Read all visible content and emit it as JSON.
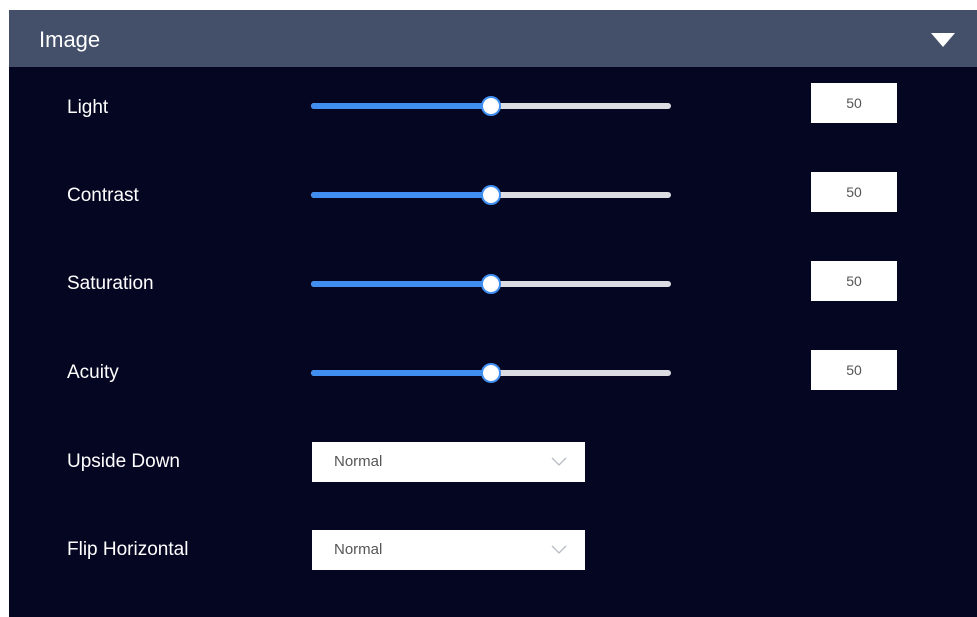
{
  "panel": {
    "title": "Image",
    "toggle_icon": "caret-down-icon"
  },
  "sliders": [
    {
      "label": "Light",
      "value": 50,
      "min": 0,
      "max": 100,
      "display": "50"
    },
    {
      "label": "Contrast",
      "value": 50,
      "min": 0,
      "max": 100,
      "display": "50"
    },
    {
      "label": "Saturation",
      "value": 50,
      "min": 0,
      "max": 100,
      "display": "50"
    },
    {
      "label": "Acuity",
      "value": 50,
      "min": 0,
      "max": 100,
      "display": "50"
    }
  ],
  "selects": [
    {
      "label": "Upside Down",
      "value": "Normal",
      "icon": "chevron-down-icon"
    },
    {
      "label": "Flip Horizontal",
      "value": "Normal",
      "icon": "chevron-down-icon"
    }
  ],
  "colors": {
    "panel_background": "#050622",
    "header_background": "#44506a",
    "slider_accent": "#3f8ef0",
    "slider_track": "#dcdde3"
  }
}
